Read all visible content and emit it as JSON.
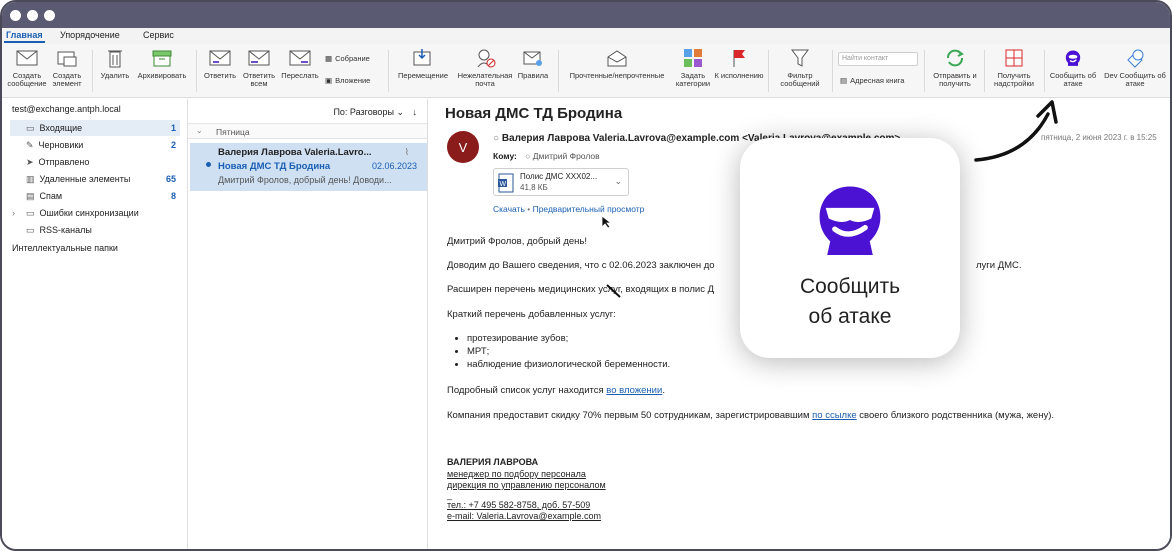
{
  "window": {
    "dot_color": "#ffffff"
  },
  "tabs": [
    "Главная",
    "Упорядочение",
    "Сервис"
  ],
  "ribbon": {
    "create_message": "Создать сообщение",
    "create_item": "Создать элемент",
    "delete": "Удалить",
    "archive": "Архивировать",
    "reply": "Ответить",
    "reply_all": "Ответить всем",
    "forward": "Переслать",
    "meeting": "Собрание",
    "attachment": "Вложение",
    "move": "Перемещение",
    "junk": "Нежелательная почта",
    "rules": "Правила",
    "read_unread": "Прочтенные/непрочтенные",
    "categorize": "Задать категории",
    "followup": "К исполнению",
    "filter": "Фильтр сообщений",
    "find_contact_placeholder": "Найти контакт",
    "address_book": "Адресная книга",
    "send_receive": "Отправить и получить",
    "get_addins": "Получить надстройки",
    "report_attack": "Сообщить об атаке",
    "dev_report": "Dev Сообщить об атаке"
  },
  "nav": {
    "account": "test@exchange.antph.local",
    "folders": [
      {
        "label": "Входящие",
        "count": "1"
      },
      {
        "label": "Черновики",
        "count": "2"
      },
      {
        "label": "Отправлено",
        "count": ""
      },
      {
        "label": "Удаленные элементы",
        "count": "65"
      },
      {
        "label": "Спам",
        "count": "8"
      },
      {
        "label": "Ошибки синхронизации",
        "count": ""
      },
      {
        "label": "RSS-каналы",
        "count": ""
      }
    ],
    "smart_folders": "Интеллектуальные папки"
  },
  "list": {
    "sort_label": "По: Разговоры",
    "group_label": "Пятница",
    "message": {
      "sender": "Валерия Лаврова Valeria.Lavro...",
      "subject": "Новая ДМС ТД Бродина",
      "date": "02.06.2023",
      "preview": "Дмитрий Фролов, добрый день! Доводи..."
    }
  },
  "reading": {
    "subject": "Новая ДМС ТД Бродина",
    "avatar_letter": "V",
    "from": "Валерия Лаврова Valeria.Lavrova@example.com <Valeria.Lavrova@example.com>",
    "date": "пятница, 2 июня 2023 г. в 15:25",
    "to_label": "Кому:",
    "to": "Дмитрий Фролов",
    "attachment_name": "Полис ДМС XXX02...",
    "attachment_size": "41,8 КБ",
    "download": "Скачать",
    "preview": "Предварительный просмотр",
    "greeting": "Дмитрий Фролов, добрый день!",
    "p1a": "Доводим до Вашего сведения, что с 02.06.2023 заключен до",
    "p1b": "луги ДМС.",
    "p2": "Расширен перечень медицинских услуг, входящих в полис Д",
    "p3": "Краткий перечень добавленных услуг:",
    "bullets": [
      "протезирование зубов;",
      "МРТ;",
      "наблюдение физиологической беременности."
    ],
    "p4a": "Подробный список услуг находится ",
    "p4link": "во вложении",
    "p4b": ".",
    "p5a": "Компания предоставит скидку 70% первым 50 сотрудникам, зарегистрировавшим ",
    "p5link": "по ссылке",
    "p5b": " своего близкого родственника (мужа, жену).",
    "sig_name": "ВАЛЕРИЯ ЛАВРОВА",
    "sig_role1": "менеджер по подбору персонала",
    "sig_role2": "дирекция по управлению персоналом",
    "sig_dash": "_",
    "sig_phone": "тел.: +7 495 582-8758, доб. 57-509",
    "sig_email": "e-mail: Valeria.Lavrova@example.com"
  },
  "popup": {
    "label_line1": "Сообщить",
    "label_line2": "об атаке",
    "accent": "#4b12d4"
  }
}
